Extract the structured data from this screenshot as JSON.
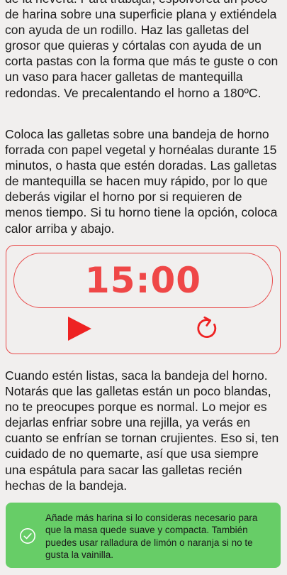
{
  "instructions": {
    "paragraph_1": "de la nevera. Para trabajar, espolvorea un poco de harina sobre una superficie plana y extiéndela con ayuda de un rodillo. Haz las galletas del grosor que quieras y córtalas con ayuda de un corta pastas con la forma que más te guste o con un vaso para hacer galletas de mantequilla redondas. Ve precalentando el horno a 180ºC.",
    "paragraph_2": "Coloca las galletas sobre una bandeja de horno forrada con papel vegetal y hornéalas durante 15 minutos, o hasta que estén doradas. Las galletas de mantequilla se hacen muy rápido, por lo que deberás vigilar el horno por si requieren de menos tiempo. Si tu horno tiene la opción, coloca calor arriba y abajo.",
    "paragraph_3": "Cuando estén listas, saca la bandeja del horno. Notarás que las galletas están un poco blandas, no te preocupes porque es normal. Lo mejor es dejarlas enfriar sobre una rejilla, ya verás en cuanto se enfrían se tornan crujientes. Eso si, ten cuidado de no quemarte, así que usa siempre una espátula para sacar las galletas recién hechas de la bandeja."
  },
  "timer": {
    "time": "15:00",
    "play_icon": "play-icon",
    "reset_icon": "restart-icon",
    "accent_color": "#ef4747"
  },
  "tip": {
    "icon": "check-circle-icon",
    "text": "Añade más harina si lo consideras necesario para que la masa quede suave y compacta. También puedes usar ralladura de limón o naranja si no te gusta la vainilla.",
    "background_color": "#67cd67"
  }
}
